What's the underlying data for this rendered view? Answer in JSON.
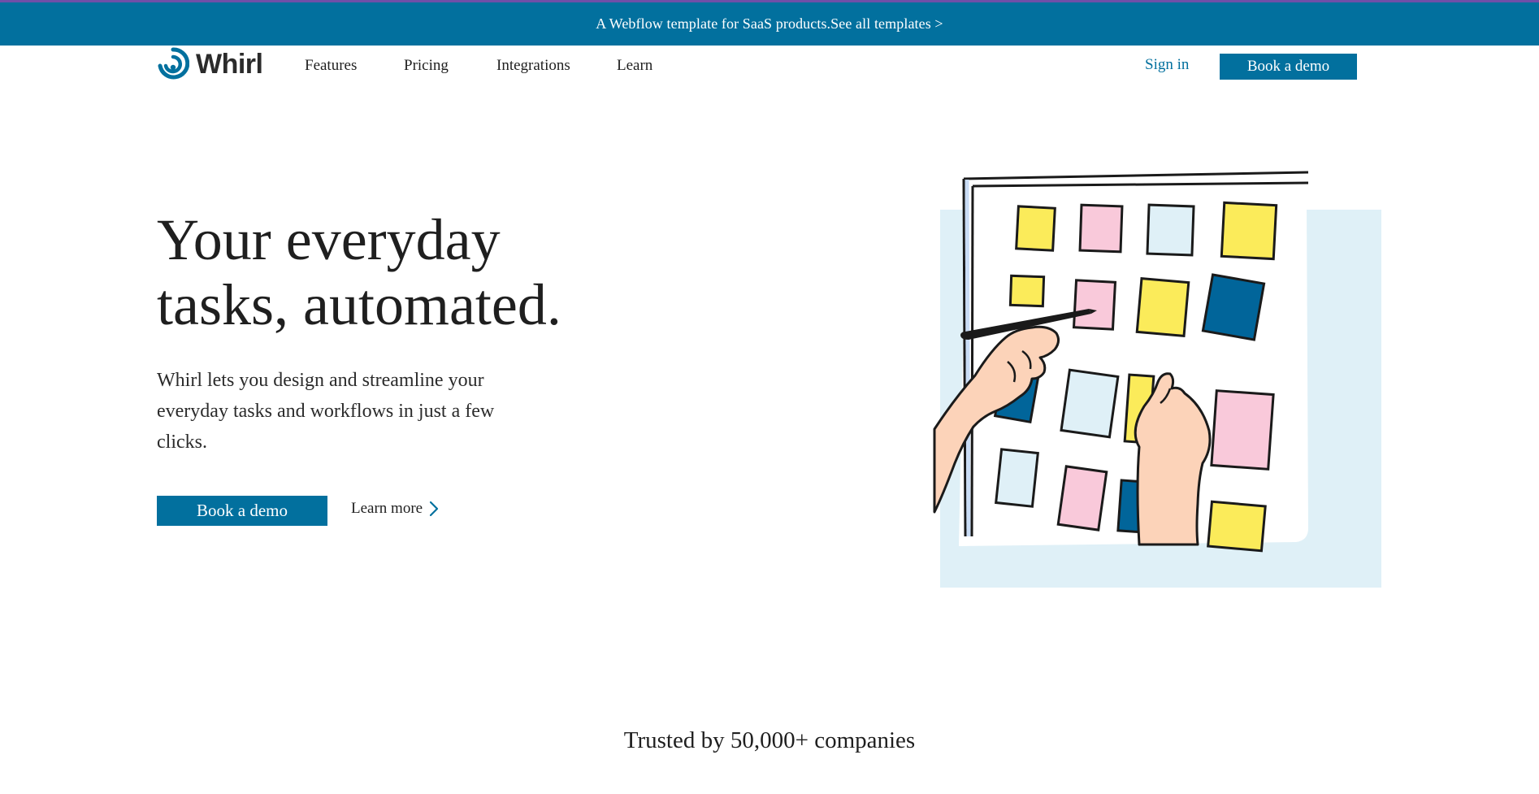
{
  "announcement": {
    "text": "A Webflow template for SaaS products.",
    "link": "See all templates >"
  },
  "nav": {
    "brand": "Whirl",
    "links": [
      "Features",
      "Pricing",
      "Integrations",
      "Learn"
    ],
    "signin": "Sign in",
    "cta": "Book a demo"
  },
  "hero": {
    "title_line1": "Your everyday",
    "title_line2": "tasks, automated.",
    "subtitle": "Whirl lets you design and streamline your everyday tasks and workflows in just a few clicks.",
    "cta": "Book a demo",
    "secondary": "Learn more"
  },
  "trusted": "Trusted by 50,000+ companies",
  "colors": {
    "brand": "#02709e",
    "accent_border": "#6f4fa8",
    "note_yellow": "#fbeb5a",
    "note_pink": "#f9c9da",
    "note_light": "#dff0f7",
    "note_blue": "#01659a",
    "backdrop": "#dff0f7",
    "skin": "#fcd3b9"
  },
  "icons": {
    "logo": "whirl-logo-icon",
    "learn_more": "chevron-right-icon",
    "illustration": "sticky-notes-board-illustration"
  }
}
